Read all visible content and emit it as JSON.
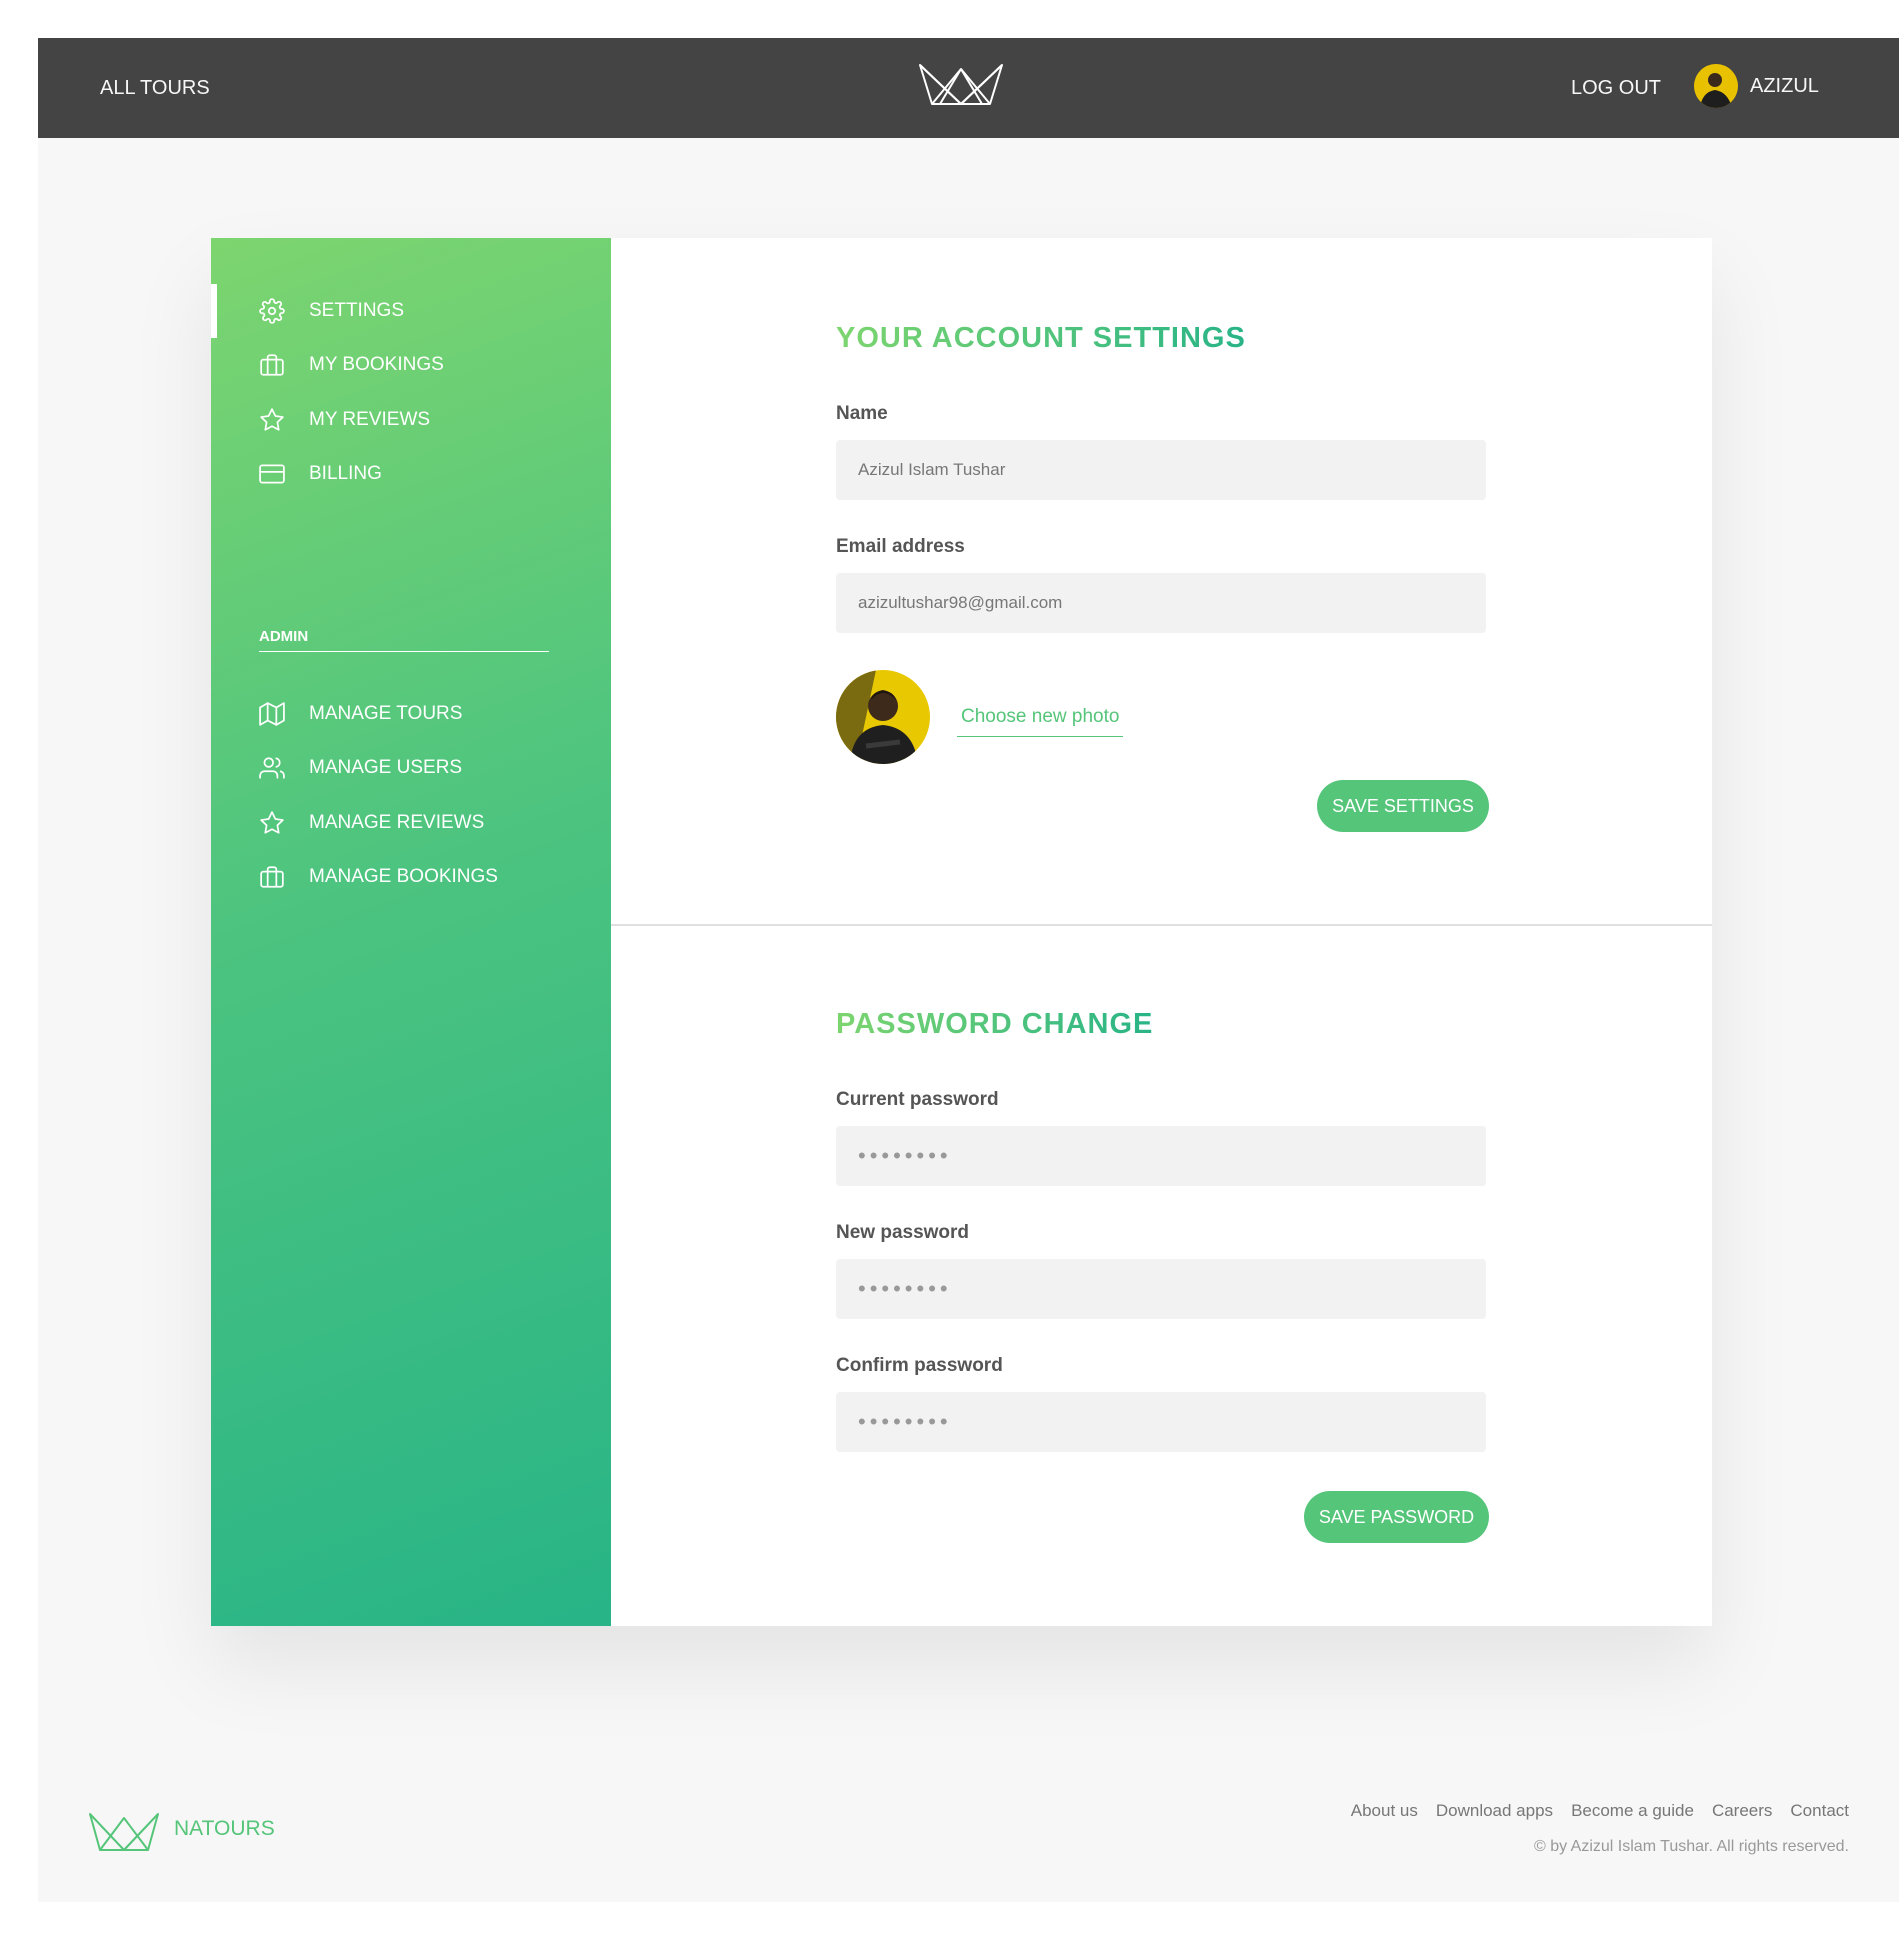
{
  "header": {
    "all_tours": "All tours",
    "logout": "Log out",
    "user_name": "Azizul"
  },
  "sidebar": {
    "items": [
      {
        "label": "Settings",
        "icon": "settings-icon",
        "active": true
      },
      {
        "label": "My bookings",
        "icon": "briefcase-icon"
      },
      {
        "label": "My reviews",
        "icon": "star-icon"
      },
      {
        "label": "Billing",
        "icon": "credit-card-icon"
      }
    ],
    "admin_heading": "Admin",
    "admin_items": [
      {
        "label": "Manage tours",
        "icon": "map-icon"
      },
      {
        "label": "Manage users",
        "icon": "users-icon"
      },
      {
        "label": "Manage reviews",
        "icon": "star-icon"
      },
      {
        "label": "Manage bookings",
        "icon": "briefcase-icon"
      }
    ]
  },
  "account": {
    "title": "Your account settings",
    "name_label": "Name",
    "name_value": "Azizul Islam Tushar",
    "email_label": "Email address",
    "email_value": "azizultushar98@gmail.com",
    "photo_link": "Choose new photo",
    "save_button": "Save settings"
  },
  "password": {
    "title": "Password change",
    "current_label": "Current password",
    "current_value": "••••••••",
    "new_label": "New password",
    "new_value": "••••••••",
    "confirm_label": "Confirm password",
    "confirm_value": "••••••••",
    "save_button": "Save password"
  },
  "footer": {
    "brand": "Natours",
    "links": [
      "About us",
      "Download apps",
      "Become a guide",
      "Careers",
      "Contact"
    ],
    "copyright": "© by Azizul Islam Tushar. All rights reserved."
  },
  "colors": {
    "header_bg": "#444444",
    "accent": "#55c57a",
    "gradient_start": "#7dd56f",
    "gradient_end": "#28b487"
  }
}
